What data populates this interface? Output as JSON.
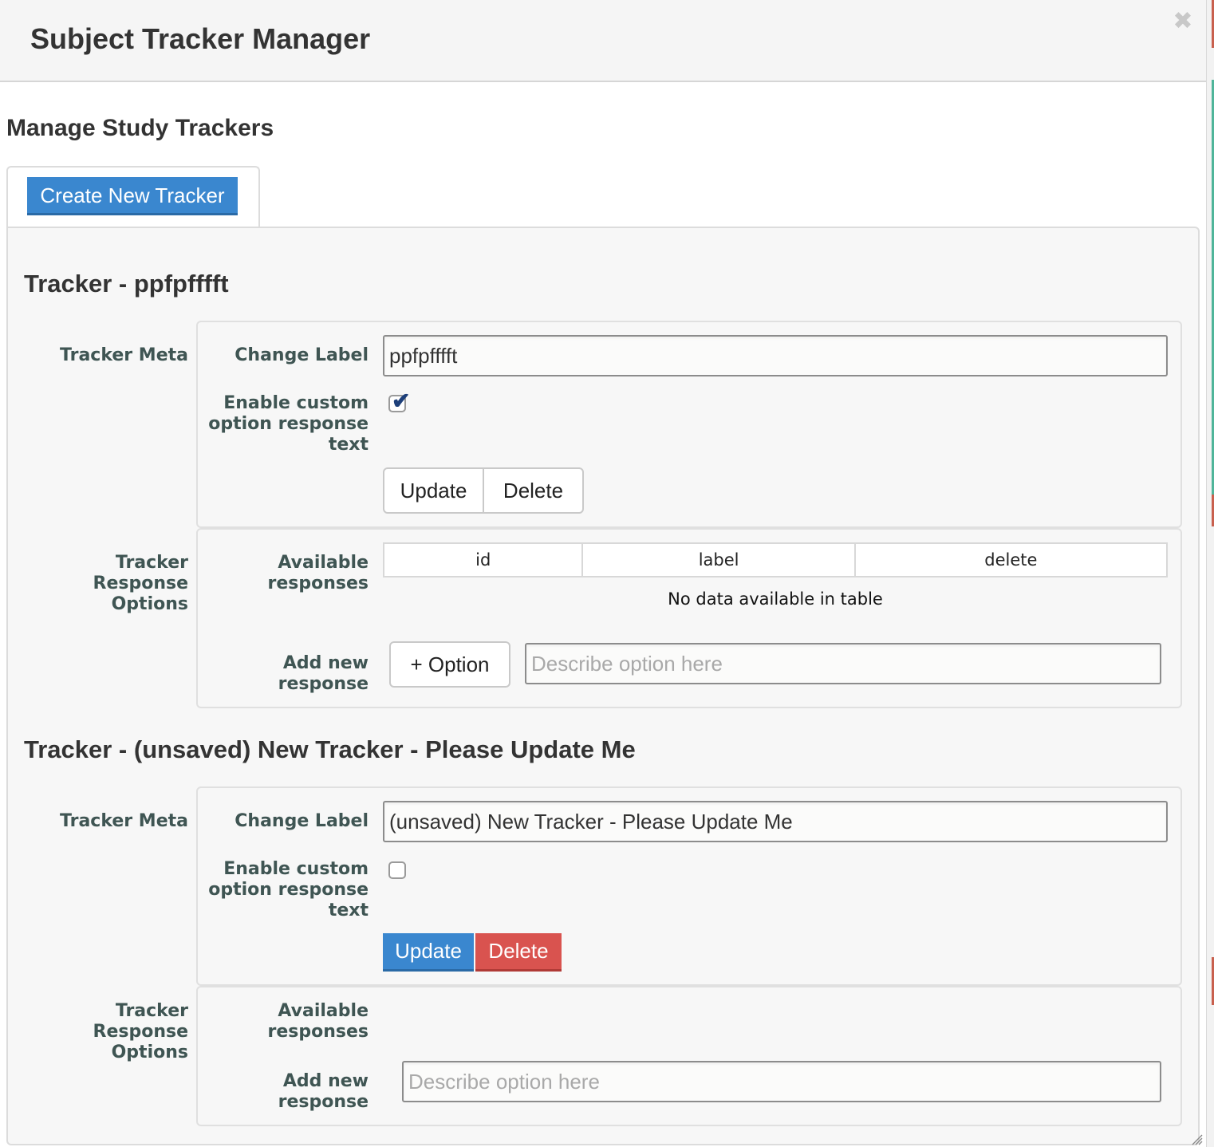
{
  "dialog": {
    "title": "Subject Tracker Manager",
    "close_icon": "close-icon"
  },
  "section_title": "Manage Study Trackers",
  "create_button_label": "Create New Tracker",
  "labels": {
    "tracker_meta": "Tracker Meta",
    "tracker_response_options": "Tracker Response Options",
    "change_label": "Change Label",
    "enable_custom": "Enable custom option response text",
    "available_responses": "Available responses",
    "add_new_response": "Add new response"
  },
  "trackers": [
    {
      "title": "Tracker - ppfpfffft",
      "label_value": "ppfpfffft",
      "custom_text_enabled": true,
      "update_label": "Update",
      "delete_label": "Delete",
      "table": {
        "columns": [
          "id",
          "label",
          "delete"
        ],
        "empty_message": "No data available in table"
      },
      "add_option_label": "+ Option",
      "option_placeholder": "Describe option here"
    },
    {
      "title": "Tracker - (unsaved) New Tracker - Please Update Me",
      "label_value": "(unsaved) New Tracker - Please Update Me",
      "custom_text_enabled": false,
      "update_label": "Update",
      "delete_label": "Delete",
      "option_placeholder": "Describe option here"
    }
  ],
  "colors": {
    "primary": "#3a87cf",
    "danger": "#d9534f",
    "label_text": "#3f5553"
  }
}
